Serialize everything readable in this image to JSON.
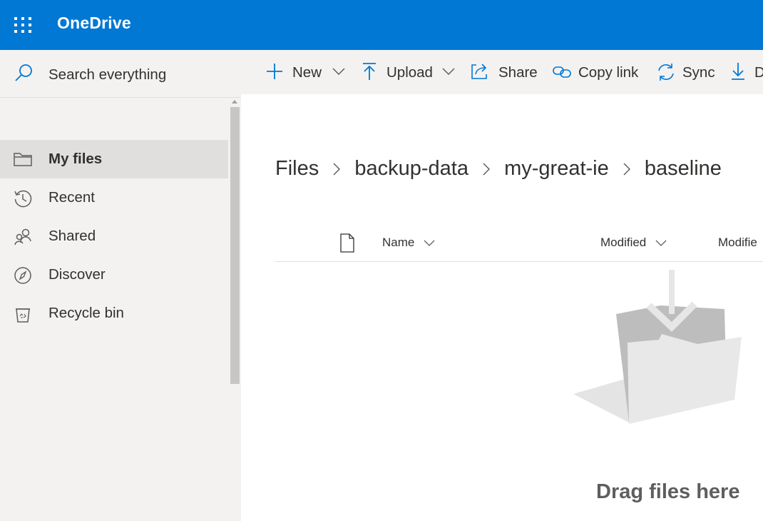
{
  "app": {
    "brand": "OneDrive"
  },
  "search": {
    "placeholder": "Search everything"
  },
  "nav": {
    "items": [
      {
        "label": "My files",
        "icon": "folder-icon",
        "active": true
      },
      {
        "label": "Recent",
        "icon": "history-icon"
      },
      {
        "label": "Shared",
        "icon": "people-icon"
      },
      {
        "label": "Discover",
        "icon": "compass-icon"
      },
      {
        "label": "Recycle bin",
        "icon": "recycle-bin-icon"
      }
    ]
  },
  "commands": {
    "new": "New",
    "upload": "Upload",
    "share": "Share",
    "copy_link": "Copy link",
    "sync": "Sync",
    "download": "D"
  },
  "breadcrumb": [
    "Files",
    "backup-data",
    "my-great-ie",
    "baseline"
  ],
  "list": {
    "columns": {
      "name": "Name",
      "modified": "Modified",
      "modified_by": "Modifie"
    }
  },
  "empty_state": {
    "text": "Drag files here"
  },
  "colors": {
    "accent": "#0078d4",
    "sidebar_bg": "#f3f2f1",
    "selected_bg": "#e1dfdd"
  }
}
